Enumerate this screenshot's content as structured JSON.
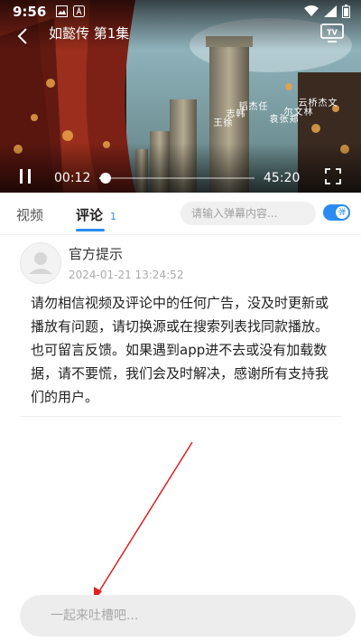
{
  "status_bar": {
    "time": "9:56"
  },
  "player": {
    "title": "如懿传 第1集",
    "time_current": "00:12",
    "time_total": "45:20",
    "progress": 0.004,
    "credits_columns": [
      "徐　王",
      "韩　志",
      "任　杰　韬",
      "郑　张　袁",
      "林　文　尔",
      "文　杰　桥　云"
    ]
  },
  "tabs": [
    {
      "label": "视频"
    },
    {
      "label": "评论",
      "count": "1"
    }
  ],
  "danmaku": {
    "placeholder": "请输入弹幕内容...",
    "toggle_label": "弹"
  },
  "comment": {
    "author": "官方提示",
    "time": "2024-01-21 13:24:52",
    "body": "请勿相信视频及评论中的任何广告，没及时更新或播放有问题，请切换源或在搜索列表找同款播放。也可留言反馈。如果遇到app进不去或没有加载数据，请不要慌，我们会及时解决，感谢所有支持我们的用户。"
  },
  "input": {
    "placeholder": "一起来吐槽吧..."
  },
  "colors": {
    "accent": "#2a8cf0",
    "arrow": "#e02020"
  }
}
